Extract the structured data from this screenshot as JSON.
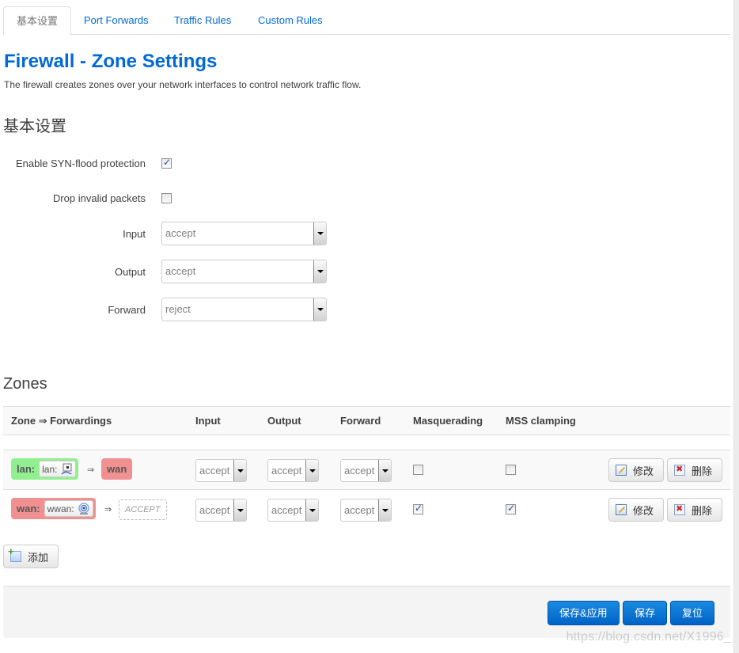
{
  "tabs": [
    {
      "label": "基本设置",
      "active": true
    },
    {
      "label": "Port Forwards",
      "active": false
    },
    {
      "label": "Traffic Rules",
      "active": false
    },
    {
      "label": "Custom Rules",
      "active": false
    }
  ],
  "page": {
    "title": "Firewall - Zone Settings",
    "description": "The firewall creates zones over your network interfaces to control network traffic flow."
  },
  "general": {
    "heading": "基本设置",
    "syn_flood": {
      "label": "Enable SYN-flood protection",
      "checked": true
    },
    "drop_invalid": {
      "label": "Drop invalid packets",
      "checked": false
    },
    "input": {
      "label": "Input",
      "value": "accept"
    },
    "output": {
      "label": "Output",
      "value": "accept"
    },
    "forward": {
      "label": "Forward",
      "value": "reject"
    }
  },
  "zones": {
    "heading": "Zones",
    "columns": [
      "Zone ⇒ Forwardings",
      "Input",
      "Output",
      "Forward",
      "Masquerading",
      "MSS clamping"
    ],
    "arrow": "⇒",
    "rows": [
      {
        "zone": "lan:",
        "zone_color": "#90f090",
        "interface": "lan:",
        "interface_icon": "ethernet-icon",
        "destination": "wan",
        "destination_color": "#f09090",
        "destination_is_policy": false,
        "input": "accept",
        "output": "accept",
        "forward": "accept",
        "masquerading": false,
        "mss_clamping": false
      },
      {
        "zone": "wan:",
        "zone_color": "#f09090",
        "interface": "wwan:",
        "interface_icon": "wireless-icon",
        "destination": "ACCEPT",
        "destination_color": "",
        "destination_is_policy": true,
        "input": "accept",
        "output": "accept",
        "forward": "accept",
        "masquerading": true,
        "mss_clamping": true
      }
    ],
    "edit_label": "修改",
    "delete_label": "删除",
    "add_label": "添加"
  },
  "footer": {
    "save_apply_label": "保存&应用",
    "save_label": "保存",
    "reset_label": "复位"
  },
  "watermark": "https://blog.csdn.net/X1996_"
}
